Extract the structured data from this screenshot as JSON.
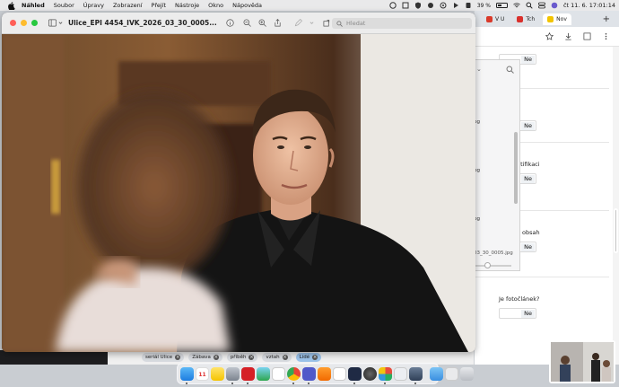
{
  "menubar": {
    "items": [
      "Náhled",
      "Soubor",
      "Úpravy",
      "Zobrazení",
      "Přejít",
      "Nástroje",
      "Okno",
      "Nápověda"
    ],
    "battery": "39 %",
    "clock": "čt 11. 6.  17:01:14"
  },
  "chrome": {
    "tabs": [
      {
        "label": "V U",
        "color": "#d93a2b"
      },
      {
        "label": "Tch",
        "color": "#d9302c"
      },
      {
        "label": "Nov",
        "color": "#f2c400"
      }
    ],
    "plus": "+",
    "fields": [
      {
        "label": "",
        "value": "Ne"
      },
      {
        "label": "ed",
        "value": "Ne"
      },
      {
        "label": "notifikaci",
        "value": "Ne"
      },
      {
        "label": "ný obsah",
        "value": "Ne"
      },
      {
        "label": "Je fotočlánek?",
        "value": "Ne"
      }
    ]
  },
  "dialog": {
    "chevron": "⌄",
    "files": [
      "pg",
      "pg",
      "pg"
    ],
    "selected_file": "03_30_0005.jpg"
  },
  "preview": {
    "title": "Ulice_EPI 4454_IVK_2026_03_30_0005...",
    "search_placeholder": "Hledat"
  },
  "tags": [
    "seriál Ulice",
    "Zábava",
    "příběh",
    "vztah",
    "Lidé"
  ],
  "colors": {
    "accent_blue": "#9cc3ea",
    "close": "#ff5f57",
    "minimize": "#febc2e",
    "zoom": "#28c840"
  },
  "dock": {
    "calendar_day": "11"
  }
}
